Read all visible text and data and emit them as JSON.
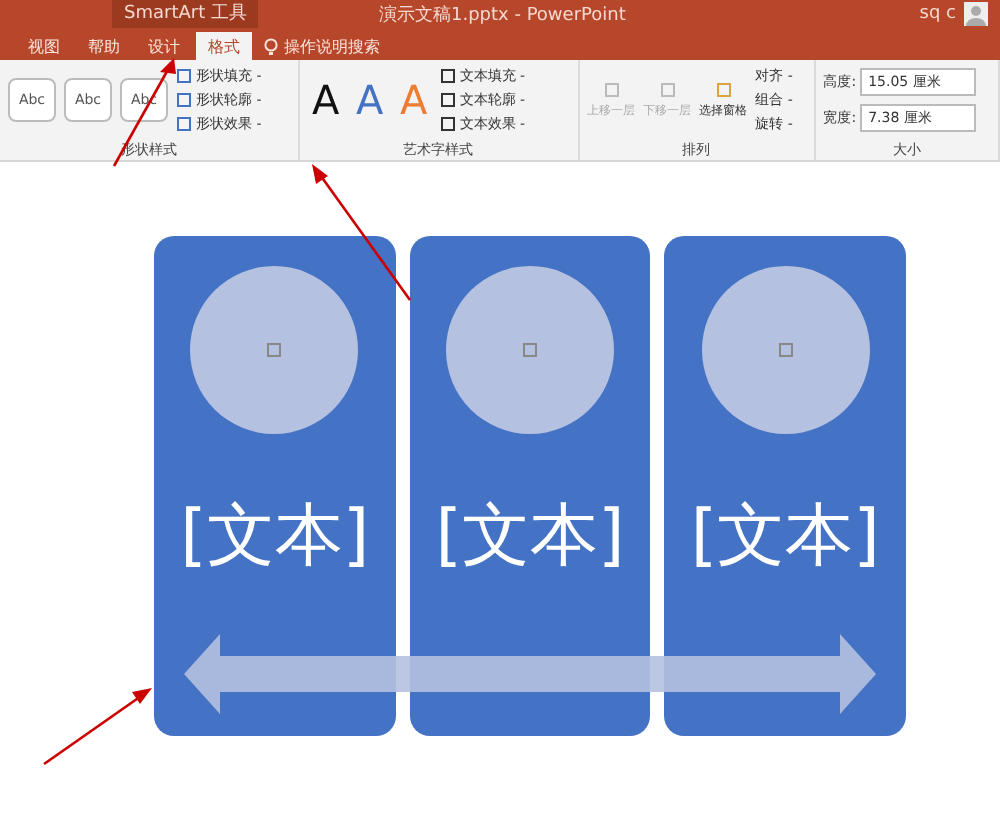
{
  "title_bar": {
    "context": "SmartArt 工具",
    "title": "演示文稿1.pptx - PowerPoint",
    "user": "sq c"
  },
  "tabs": [
    {
      "label": "视图",
      "selected": false
    },
    {
      "label": "帮助",
      "selected": false
    },
    {
      "label": "设计",
      "selected": false
    },
    {
      "label": "格式",
      "selected": true
    }
  ],
  "tell_me": "操作说明搜索",
  "ribbon": {
    "shape_styles": {
      "label": "形状样式",
      "swatches": [
        "Abc",
        "Abc",
        "Abc"
      ],
      "commands": [
        "形状填充 -",
        "形状轮廓 -",
        "形状效果 -"
      ]
    },
    "wordart_styles": {
      "label": "艺术字样式",
      "letters": [
        {
          "text": "A",
          "color": "#111111"
        },
        {
          "text": "A",
          "color": "#4472c4"
        },
        {
          "text": "A",
          "color": "#ed7d31"
        }
      ],
      "commands": [
        "文本填充 -",
        "文本轮廓 -",
        "文本效果 -"
      ]
    },
    "arrange": {
      "label": "排列",
      "big": [
        {
          "label": "上移一层",
          "disabled": true
        },
        {
          "label": "下移一层",
          "disabled": true
        },
        {
          "label": "选择窗格",
          "disabled": false
        }
      ],
      "commands": [
        "对齐 -",
        "组合 -",
        "旋转 -"
      ]
    },
    "size": {
      "label": "大小",
      "fields": [
        {
          "label": "高度:",
          "value": "15.05 厘米"
        },
        {
          "label": "宽度:",
          "value": "7.38 厘米"
        }
      ]
    }
  },
  "smartart": {
    "cards": [
      {
        "text": "[文本]"
      },
      {
        "text": "[文本]"
      },
      {
        "text": "[文本]"
      }
    ]
  }
}
